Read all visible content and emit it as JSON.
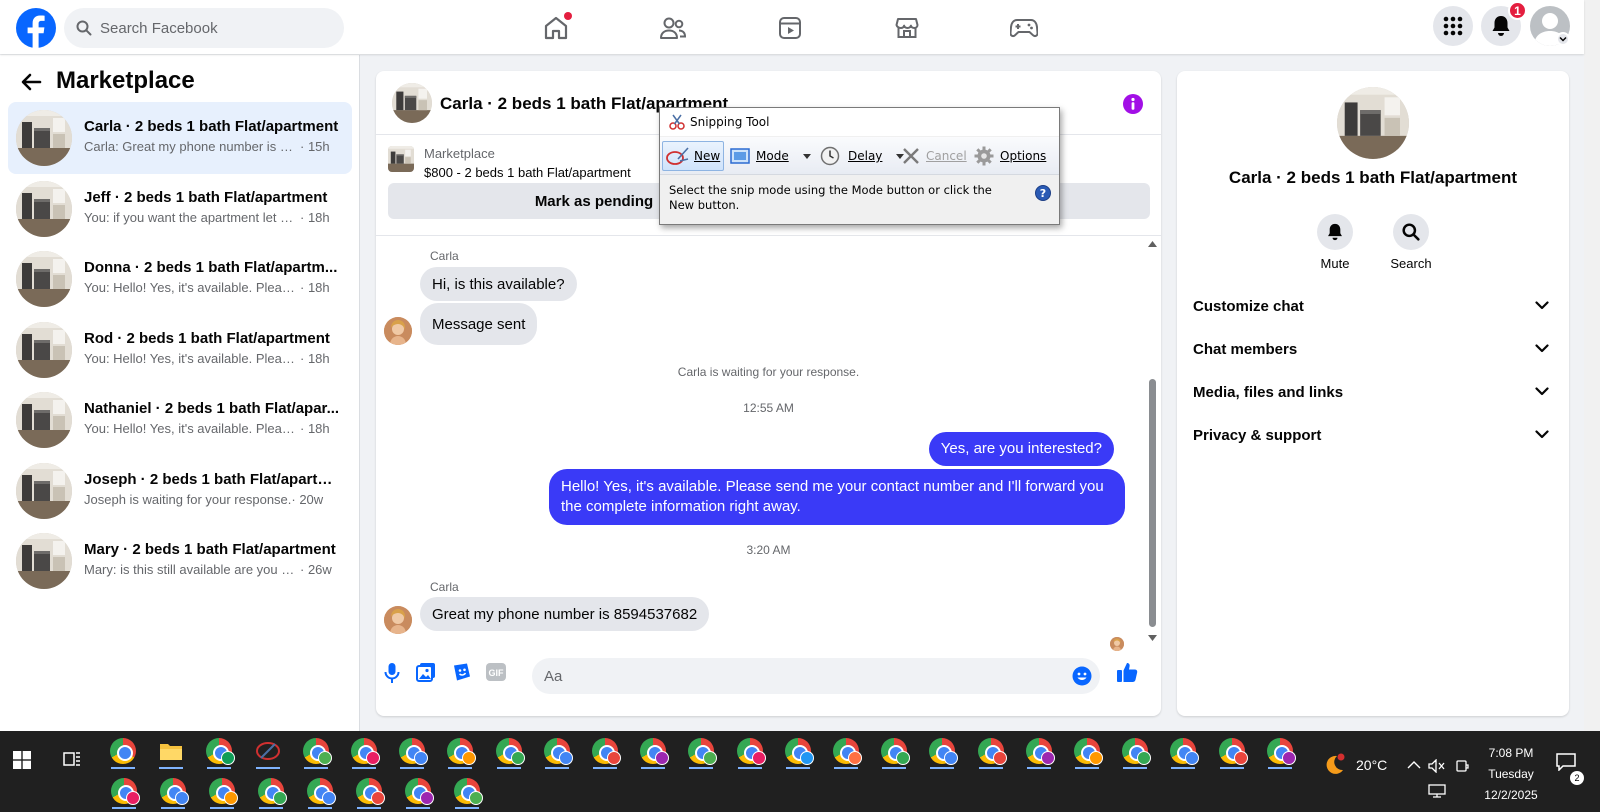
{
  "topbar": {
    "search_placeholder": "Search Facebook",
    "notification_count": "1"
  },
  "sidebar": {
    "title": "Marketplace",
    "conversations": [
      {
        "title": "Carla · 2 beds 1 bath Flat/apartment",
        "preview": "Carla: Great my phone number is 85...",
        "time": " · 15h",
        "active": true
      },
      {
        "title": "Jeff · 2 beds 1 bath Flat/apartment",
        "preview": "You: if you want the apartment let m...",
        "time": " · 18h"
      },
      {
        "title": "Donna · 2 beds 1 bath Flat/apartm...",
        "preview": "You: Hello! Yes, it's available. Please s...",
        "time": " · 18h"
      },
      {
        "title": "Rod · 2 beds 1 bath Flat/apartment",
        "preview": "You: Hello! Yes, it's available. Please s...",
        "time": " · 18h"
      },
      {
        "title": "Nathaniel · 2 beds 1 bath Flat/apar...",
        "preview": "You: Hello! Yes, it's available. Please s...",
        "time": " · 18h"
      },
      {
        "title": "Joseph · 2 beds 1 bath Flat/apartm...",
        "preview": "Joseph is waiting for your response.",
        "time": " · 20w"
      },
      {
        "title": "Mary · 2 beds 1 bath Flat/apartment",
        "preview": "Mary: is this still available are you pe...",
        "time": " · 26w"
      }
    ]
  },
  "chat": {
    "title": "Carla · 2 beds 1 bath Flat/apartment",
    "listing_label": "Marketplace",
    "listing_price": "$800 - 2 beds 1 bath Flat/apartment",
    "pending_button": "Mark as pending",
    "sender_name_1": "Carla",
    "msg_1": "Hi, is this available?",
    "msg_2": "Message sent",
    "waiting_note": "Carla is waiting for your response.",
    "timestamp_1": "12:55 AM",
    "msg_3": "Yes, are you interested?",
    "msg_4": "Hello! Yes, it's available. Please send me your contact number and I'll forward you the complete information right away.",
    "timestamp_2": "3:20 AM",
    "sender_name_2": "Carla",
    "msg_5": "Great my phone number is 8594537682",
    "input_placeholder": "Aa",
    "accent_color": "#3a3af7"
  },
  "details": {
    "name": "Carla · 2 beds 1 bath Flat/apartment",
    "mute_label": "Mute",
    "search_label": "Search",
    "sections": [
      "Customize chat",
      "Chat members",
      "Media, files and links",
      "Privacy & support"
    ]
  },
  "snipping_tool": {
    "title": "Snipping Tool",
    "new_label": "New",
    "mode_label": "Mode",
    "delay_label": "Delay",
    "cancel_label": "Cancel",
    "options_label": "Options",
    "message": "Select the snip mode using the Mode button or click the New button."
  },
  "taskbar": {
    "temperature": "20°C",
    "time": "7:08 PM",
    "day": "Tuesday",
    "date": "12/2/2025",
    "notification_count": "2"
  }
}
